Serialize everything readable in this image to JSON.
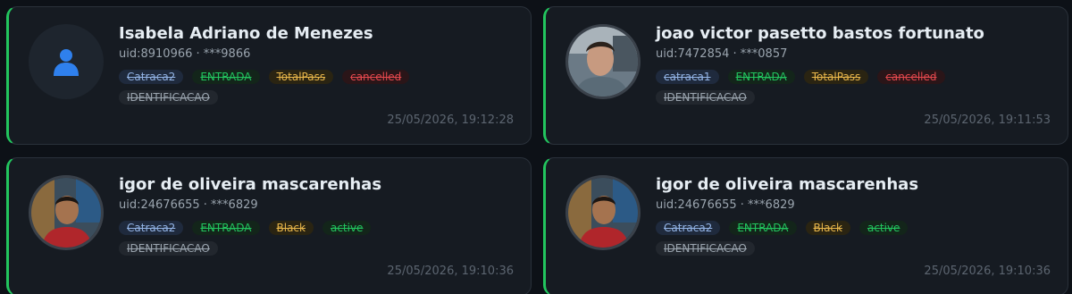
{
  "cards": [
    {
      "name": "Isabela Adriano de Menezes",
      "uid": "uid:8910966 · ***9866",
      "avatar_icon": "user-silhouette-icon",
      "badges": {
        "gate": "Catraca2",
        "direction": "ENTRADA",
        "plan": "TotalPass",
        "status": "cancelled",
        "method": "IDENTIFICACAO"
      },
      "timestamp": "25/05/2026, 19:12:28"
    },
    {
      "name": "joao victor pasetto bastos fortunato",
      "uid": "uid:7472854 · ***0857",
      "avatar_icon": "user-photo",
      "badges": {
        "gate": "catraca1",
        "direction": "ENTRADA",
        "plan": "TotalPass",
        "status": "cancelled",
        "method": "IDENTIFICACAO"
      },
      "timestamp": "25/05/2026, 19:11:53"
    },
    {
      "name": "igor de oliveira mascarenhas",
      "uid": "uid:24676655 · ***6829",
      "avatar_icon": "user-photo",
      "badges": {
        "gate": "Catraca2",
        "direction": "ENTRADA",
        "plan": "Black",
        "status": "active",
        "method": "IDENTIFICACAO"
      },
      "timestamp": "25/05/2026, 19:10:36"
    },
    {
      "name": "igor de oliveira mascarenhas",
      "uid": "uid:24676655 · ***6829",
      "avatar_icon": "user-photo",
      "badges": {
        "gate": "Catraca2",
        "direction": "ENTRADA",
        "plan": "Black",
        "status": "active",
        "method": "IDENTIFICACAO"
      },
      "timestamp": "25/05/2026, 19:10:36"
    }
  ],
  "colors": {
    "accent_green": "#22c55e",
    "cancelled_red": "#e5484d",
    "plan_yellow": "#e8b64a",
    "gate_blue": "#93b4e6"
  }
}
